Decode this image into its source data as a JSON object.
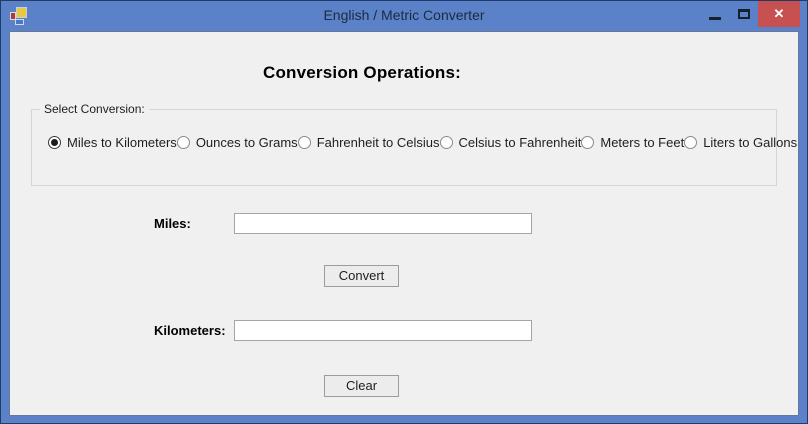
{
  "window": {
    "title": "English / Metric Converter",
    "controls": {
      "minimize": "minimize",
      "maximize": "maximize",
      "close": "close",
      "close_glyph": "✕"
    }
  },
  "heading": "Conversion Operations:",
  "conversion_group": {
    "label": "Select Conversion:",
    "options": [
      {
        "label": "Miles to Kilometers",
        "selected": true
      },
      {
        "label": "Ounces to Grams",
        "selected": false
      },
      {
        "label": "Fahrenheit to Celsius",
        "selected": false
      },
      {
        "label": "Celsius to Fahrenheit",
        "selected": false
      },
      {
        "label": "Meters to Feet",
        "selected": false
      },
      {
        "label": "Liters to Gallons",
        "selected": false
      }
    ]
  },
  "converter": {
    "input_label": "Miles:",
    "input_value": "",
    "output_label": "Kilometers:",
    "output_value": "",
    "convert_button": "Convert",
    "clear_button": "Clear"
  },
  "colors": {
    "titlebar": "#5B82C8",
    "close_button": "#C75050",
    "client_bg": "#F0F0F0",
    "groupbox_border": "#D5D5D8"
  }
}
